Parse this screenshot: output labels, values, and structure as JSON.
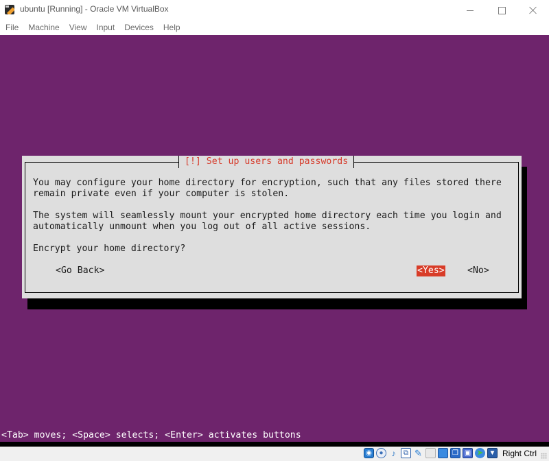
{
  "window": {
    "title": "ubuntu [Running] - Oracle VM VirtualBox",
    "app_icon": "virtualbox-icon",
    "controls": {
      "minimize": "minimize-icon",
      "maximize": "maximize-icon",
      "close": "close-icon"
    }
  },
  "menubar": {
    "items": [
      {
        "label": "File"
      },
      {
        "label": "Machine"
      },
      {
        "label": "View"
      },
      {
        "label": "Input"
      },
      {
        "label": "Devices"
      },
      {
        "label": "Help"
      }
    ]
  },
  "installer": {
    "background_color": "#6e246c",
    "dialog": {
      "title": "[!] Set up users and passwords",
      "title_color": "#d63a2a",
      "paragraph1": "You may configure your home directory for encryption, such that any files stored there\nremain private even if your computer is stolen.",
      "paragraph2": "The system will seamlessly mount your encrypted home directory each time you login and\nautomatically unmount when you log out of all active sessions.",
      "question": "Encrypt your home directory?",
      "buttons": {
        "go_back": "<Go Back>",
        "yes": "<Yes>",
        "no": "<No>"
      },
      "selected_button": "yes",
      "selected_color": "#d83c28"
    },
    "help_line": "<Tab> moves; <Space> selects; <Enter> activates buttons"
  },
  "statusbar": {
    "icons": [
      "hard-disk-icon",
      "optical-drive-icon",
      "audio-icon",
      "network-icon",
      "usb-icon",
      "shared-folders-icon",
      "display-icon",
      "video-capture-icon",
      "cpu-icon",
      "guest-additions-icon",
      "mouse-integration-icon"
    ],
    "host_key": "Right Ctrl"
  }
}
